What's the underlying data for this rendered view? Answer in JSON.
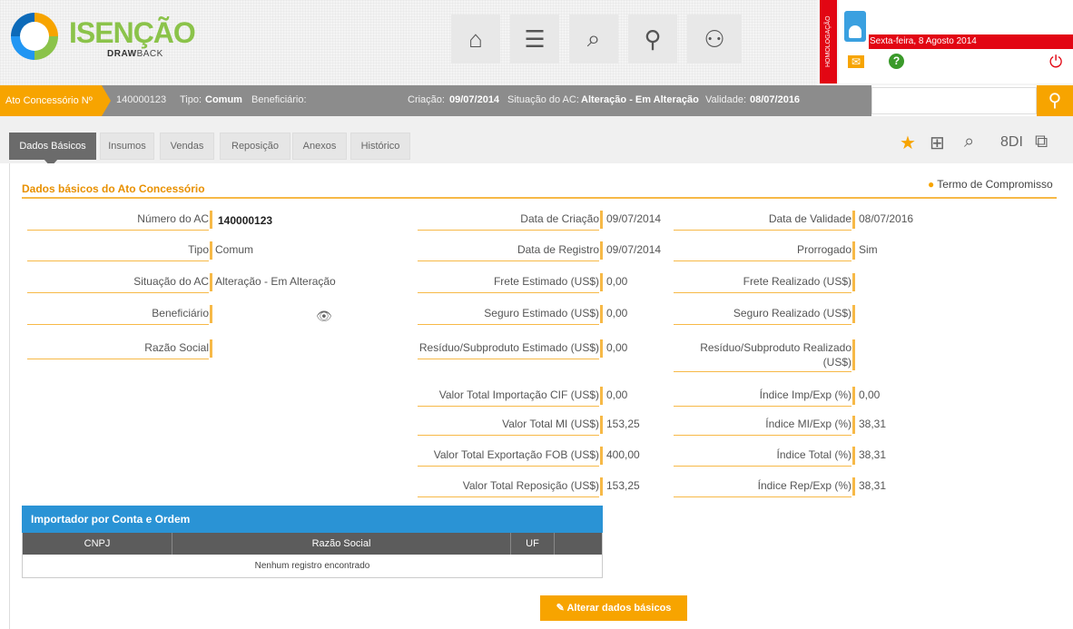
{
  "app": {
    "logo_title": "ISENÇÃO",
    "logo_subtitle_bold": "DRAW",
    "logo_subtitle_rest": "BACK",
    "environment": "HOMOLOGAÇÃO",
    "date": "Sexta-feira, 8 Agosto 2014"
  },
  "nav_icons": [
    "home-icon",
    "document-list-icon",
    "search-documents-icon",
    "search-plus-icon",
    "users-monitor-icon"
  ],
  "infobar": {
    "tag": "Ato Concessório Nº",
    "number": "140000123",
    "tipo_label": "Tipo:",
    "tipo_value": "Comum",
    "beneficiario_label": "Beneficiário:",
    "criacao_label": "Criação:",
    "criacao_value": "09/07/2014",
    "situacao_label": "Situação do AC:",
    "situacao_value": "Alteração - Em Alteração",
    "validade_label": "Validade:",
    "validade_value": "08/07/2016"
  },
  "tabs": [
    "Dados Básicos",
    "Insumos",
    "Vendas",
    "Reposição",
    "Anexos",
    "Histórico"
  ],
  "section": {
    "title": "Dados básicos do Ato Concessório",
    "termo": "Termo de Compromisso"
  },
  "fields": {
    "numero_ac": {
      "label": "Número do AC",
      "value": "140000123"
    },
    "tipo": {
      "label": "Tipo",
      "value": "Comum"
    },
    "situacao": {
      "label": "Situação do AC",
      "value": "Alteração - Em Alteração"
    },
    "beneficiario": {
      "label": "Beneficiário",
      "value": ""
    },
    "razao_social": {
      "label": "Razão Social",
      "value": ""
    },
    "data_criacao": {
      "label": "Data de Criação",
      "value": "09/07/2014"
    },
    "data_registro": {
      "label": "Data de Registro",
      "value": "09/07/2014"
    },
    "frete_estimado": {
      "label": "Frete Estimado (US$)",
      "value": "0,00"
    },
    "seguro_estimado": {
      "label": "Seguro Estimado (US$)",
      "value": "0,00"
    },
    "residuo_estimado": {
      "label": "Resíduo/Subproduto Estimado (US$)",
      "value": "0,00"
    },
    "valor_importacao_cif": {
      "label": "Valor Total Importação CIF (US$)",
      "value": "0,00"
    },
    "valor_mi": {
      "label": "Valor Total MI (US$)",
      "value": "153,25"
    },
    "valor_exportacao_fob": {
      "label": "Valor Total Exportação FOB (US$)",
      "value": "400,00"
    },
    "valor_reposicao": {
      "label": "Valor Total Reposição (US$)",
      "value": "153,25"
    },
    "data_validade": {
      "label": "Data de Validade",
      "value": "08/07/2016"
    },
    "prorrogado": {
      "label": "Prorrogado",
      "value": "Sim"
    },
    "frete_realizado": {
      "label": "Frete Realizado (US$)",
      "value": ""
    },
    "seguro_realizado": {
      "label": "Seguro Realizado (US$)",
      "value": ""
    },
    "residuo_realizado_l1": {
      "label": "Resíduo/Subproduto Realizado",
      "value": ""
    },
    "residuo_realizado_l2": {
      "label": "(US$)",
      "value": ""
    },
    "indice_imp_exp": {
      "label": "Índice Imp/Exp (%)",
      "value": "0,00"
    },
    "indice_mi_exp": {
      "label": "Índice MI/Exp (%)",
      "value": "38,31"
    },
    "indice_total": {
      "label": "Índice Total (%)",
      "value": "38,31"
    },
    "indice_rep_exp": {
      "label": "Índice Rep/Exp (%)",
      "value": "38,31"
    }
  },
  "importador": {
    "title": "Importador por Conta e Ordem",
    "columns": [
      "CNPJ",
      "Razão Social",
      "UF"
    ],
    "empty": "Nenhum registro encontrado"
  },
  "actions": {
    "alterar": "Alterar dados básicos"
  },
  "colors": {
    "accent": "#f7a400",
    "header_gray": "#8c8c8c",
    "table_blue": "#2a93d5",
    "environment_red": "#e20613"
  }
}
